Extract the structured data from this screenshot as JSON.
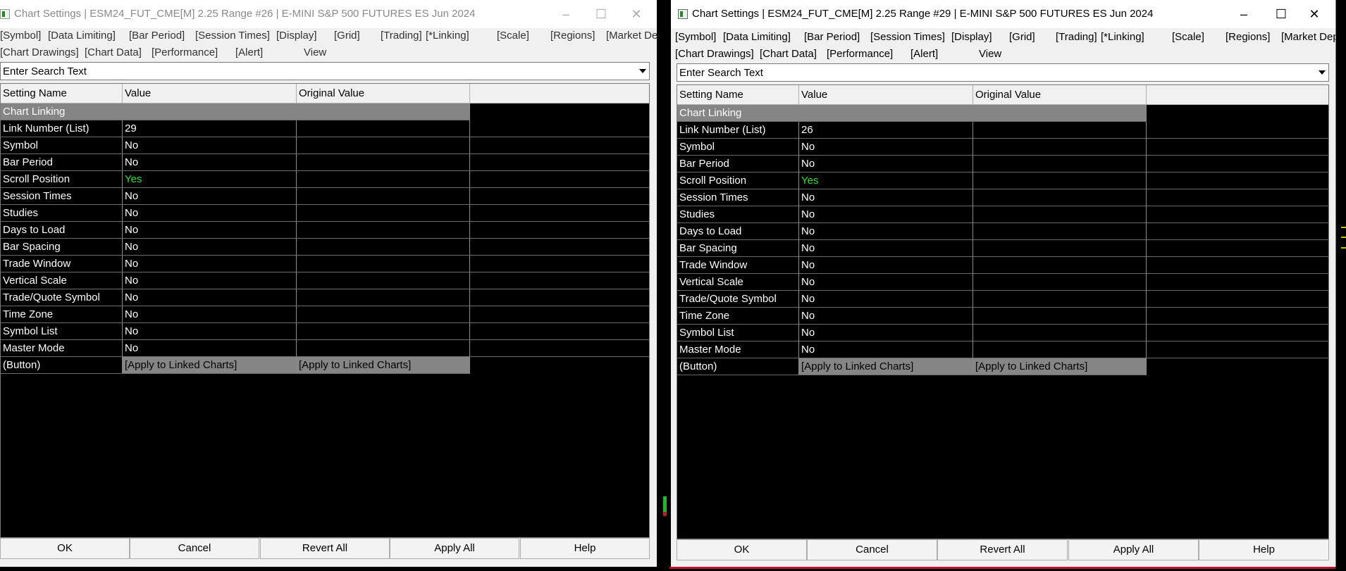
{
  "windows": [
    {
      "title": "Chart Settings | ESM24_FUT_CME[M]  2.25 Range #26 | E-MINI S&P 500 FUTURES ES Jun 2024",
      "menu_items": [
        "[Symbol]",
        "[Data Limiting]",
        "[Bar Period]",
        "[Session Times]",
        "[Display]",
        "[Grid]",
        "[Trading]",
        "[*Linking]",
        "[Scale]",
        "[Regions]",
        "[Market Depth]",
        "[Chart Drawings]",
        "[Chart Data]",
        "[Performance]",
        "[Alert]",
        "View"
      ],
      "search_placeholder": "Enter Search Text",
      "columns": [
        "Setting Name",
        "Value",
        "Original Value",
        ""
      ],
      "section": "Chart Linking",
      "rows": [
        {
          "name": "Link Number (List)",
          "value": "29"
        },
        {
          "name": "Symbol",
          "value": "No"
        },
        {
          "name": "Bar Period",
          "value": "No"
        },
        {
          "name": "Scroll Position",
          "value": "Yes"
        },
        {
          "name": "Session Times",
          "value": "No"
        },
        {
          "name": "Studies",
          "value": "No"
        },
        {
          "name": "Days to Load",
          "value": "No"
        },
        {
          "name": "Bar Spacing",
          "value": "No"
        },
        {
          "name": "Trade Window",
          "value": "No"
        },
        {
          "name": "Vertical Scale",
          "value": "No"
        },
        {
          "name": "Trade/Quote Symbol",
          "value": "No"
        },
        {
          "name": "Time Zone",
          "value": "No"
        },
        {
          "name": "Symbol List",
          "value": "No"
        },
        {
          "name": "Master Mode",
          "value": "No"
        }
      ],
      "button_row": {
        "name": " (Button)",
        "value": "[Apply to Linked Charts]",
        "original": "[Apply to Linked Charts]"
      },
      "buttons": [
        "OK",
        "Cancel",
        "Revert All",
        "Apply All",
        "Help"
      ]
    },
    {
      "title": "Chart Settings | ESM24_FUT_CME[M]  2.25 Range #29 | E-MINI S&P 500 FUTURES ES Jun 2024",
      "menu_items": [
        "[Symbol]",
        "[Data Limiting]",
        "[Bar Period]",
        "[Session Times]",
        "[Display]",
        "[Grid]",
        "[Trading]",
        "[*Linking]",
        "[Scale]",
        "[Regions]",
        "[Market Depth]",
        "[Chart Drawings]",
        "[Chart Data]",
        "[Performance]",
        "[Alert]",
        "View"
      ],
      "search_placeholder": "Enter Search Text",
      "columns": [
        "Setting Name",
        "Value",
        "Original Value",
        ""
      ],
      "section": "Chart Linking",
      "rows": [
        {
          "name": "Link Number (List)",
          "value": "26"
        },
        {
          "name": "Symbol",
          "value": "No"
        },
        {
          "name": "Bar Period",
          "value": "No"
        },
        {
          "name": "Scroll Position",
          "value": "Yes"
        },
        {
          "name": "Session Times",
          "value": "No"
        },
        {
          "name": "Studies",
          "value": "No"
        },
        {
          "name": "Days to Load",
          "value": "No"
        },
        {
          "name": "Bar Spacing",
          "value": "No"
        },
        {
          "name": "Trade Window",
          "value": "No"
        },
        {
          "name": "Vertical Scale",
          "value": "No"
        },
        {
          "name": "Trade/Quote Symbol",
          "value": "No"
        },
        {
          "name": "Time Zone",
          "value": "No"
        },
        {
          "name": "Symbol List",
          "value": "No"
        },
        {
          "name": "Master Mode",
          "value": "No"
        }
      ],
      "button_row": {
        "name": " (Button)",
        "value": "[Apply to Linked Charts]",
        "original": "[Apply to Linked Charts]"
      },
      "buttons": [
        "OK",
        "Cancel",
        "Revert All",
        "Apply All",
        "Help"
      ]
    }
  ],
  "colors": {
    "yes": "#2de02d",
    "section": "#858585",
    "grid_bg": "#000000"
  },
  "icons": {
    "minimize": "minimize-icon",
    "maximize": "maximize-icon",
    "close": "close-icon",
    "dropdown": "chevron-down-icon"
  }
}
